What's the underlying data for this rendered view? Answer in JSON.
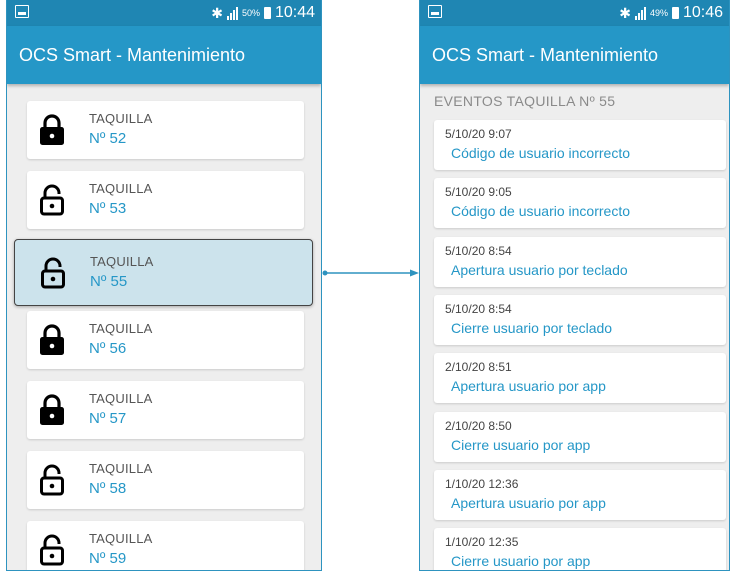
{
  "left_screen": {
    "status_bar": {
      "battery_pct": "50%",
      "time": "10:44"
    },
    "app_title": "OCS Smart - Mantenimiento",
    "lockers": [
      {
        "label": "TAQUILLA",
        "number": "Nº 52",
        "lock_state": "locked"
      },
      {
        "label": "TAQUILLA",
        "number": "Nº 53",
        "lock_state": "unlocked"
      },
      {
        "label": "TAQUILLA",
        "number": "Nº 55",
        "lock_state": "unlocked",
        "selected": true
      },
      {
        "label": "TAQUILLA",
        "number": "Nº 56",
        "lock_state": "locked"
      },
      {
        "label": "TAQUILLA",
        "number": "Nº 57",
        "lock_state": "locked"
      },
      {
        "label": "TAQUILLA",
        "number": "Nº 58",
        "lock_state": "unlocked"
      },
      {
        "label": "TAQUILLA",
        "number": "Nº 59",
        "lock_state": "unlocked"
      }
    ]
  },
  "right_screen": {
    "status_bar": {
      "battery_pct": "49%",
      "time": "10:46"
    },
    "app_title": "OCS Smart - Mantenimiento",
    "events_title": "EVENTOS TAQUILLA Nº 55",
    "events": [
      {
        "date": "5/10/20 9:07",
        "description": "Código de usuario incorrecto"
      },
      {
        "date": "5/10/20 9:05",
        "description": "Código de usuario incorrecto"
      },
      {
        "date": "5/10/20 8:54",
        "description": "Apertura usuario por teclado"
      },
      {
        "date": "5/10/20 8:54",
        "description": "Cierre usuario por teclado"
      },
      {
        "date": "2/10/20 8:51",
        "description": "Apertura usuario por app"
      },
      {
        "date": "2/10/20 8:50",
        "description": "Cierre usuario por app"
      },
      {
        "date": "1/10/20 12:36",
        "description": "Apertura usuario por app"
      },
      {
        "date": "1/10/20 12:35",
        "description": "Cierre usuario por app"
      }
    ]
  },
  "colors": {
    "status_bar": "#1f86b3",
    "app_bar": "#2597c7",
    "accent_text": "#2597c7",
    "selected_bg": "#cce3ec",
    "background": "#eeeeee"
  },
  "icons": {
    "locked": "padlock-closed-icon",
    "unlocked": "padlock-open-icon",
    "bluetooth": "bluetooth-icon",
    "signal": "signal-icon",
    "battery": "battery-icon",
    "notification": "notification-icon"
  }
}
